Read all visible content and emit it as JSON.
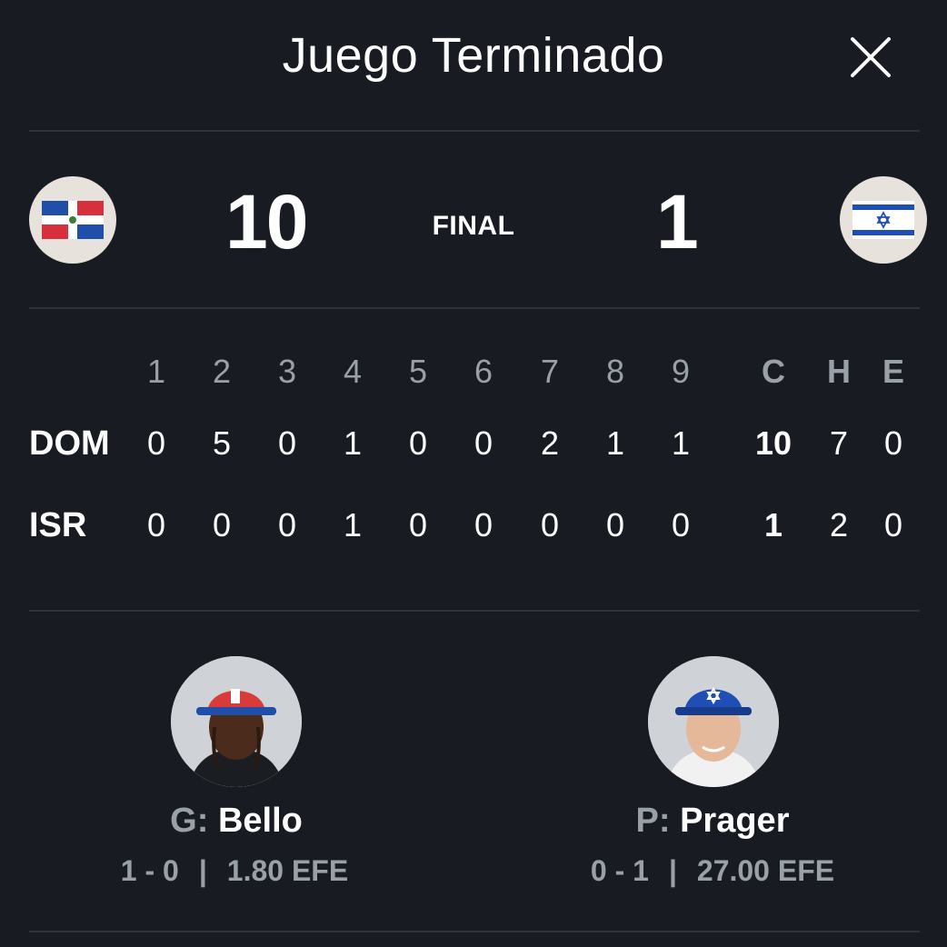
{
  "header": {
    "title": "Juego Terminado"
  },
  "game": {
    "status": "FINAL",
    "home": {
      "abbr": "DOM",
      "score": "10",
      "flag": "dominican-republic-flag"
    },
    "away": {
      "abbr": "ISR",
      "score": "1",
      "flag": "israel-flag"
    }
  },
  "linescore": {
    "innings": [
      "1",
      "2",
      "3",
      "4",
      "5",
      "6",
      "7",
      "8",
      "9"
    ],
    "totals_headers": [
      "C",
      "H",
      "E"
    ],
    "rows": [
      {
        "team": "DOM",
        "innings": [
          "0",
          "5",
          "0",
          "1",
          "0",
          "0",
          "2",
          "1",
          "1"
        ],
        "totals": [
          "10",
          "7",
          "0"
        ]
      },
      {
        "team": "ISR",
        "innings": [
          "0",
          "0",
          "0",
          "1",
          "0",
          "0",
          "0",
          "0",
          "0"
        ],
        "totals": [
          "1",
          "2",
          "0"
        ]
      }
    ]
  },
  "pitchers": {
    "winner": {
      "prefix": "G:",
      "name": "Bello",
      "record": "1 - 0",
      "era": "1.80 EFE"
    },
    "loser": {
      "prefix": "P:",
      "name": "Prager",
      "record": "0 - 1",
      "era": "27.00 EFE"
    }
  },
  "colors": {
    "background": "#181c22",
    "divider": "#2c333d",
    "muted_text": "#9aa0a8",
    "flag_bg": "#e8e2dc",
    "dom_blue": "#1f4fa8",
    "dom_red": "#d6303d",
    "isr_blue": "#1e4fb6"
  }
}
